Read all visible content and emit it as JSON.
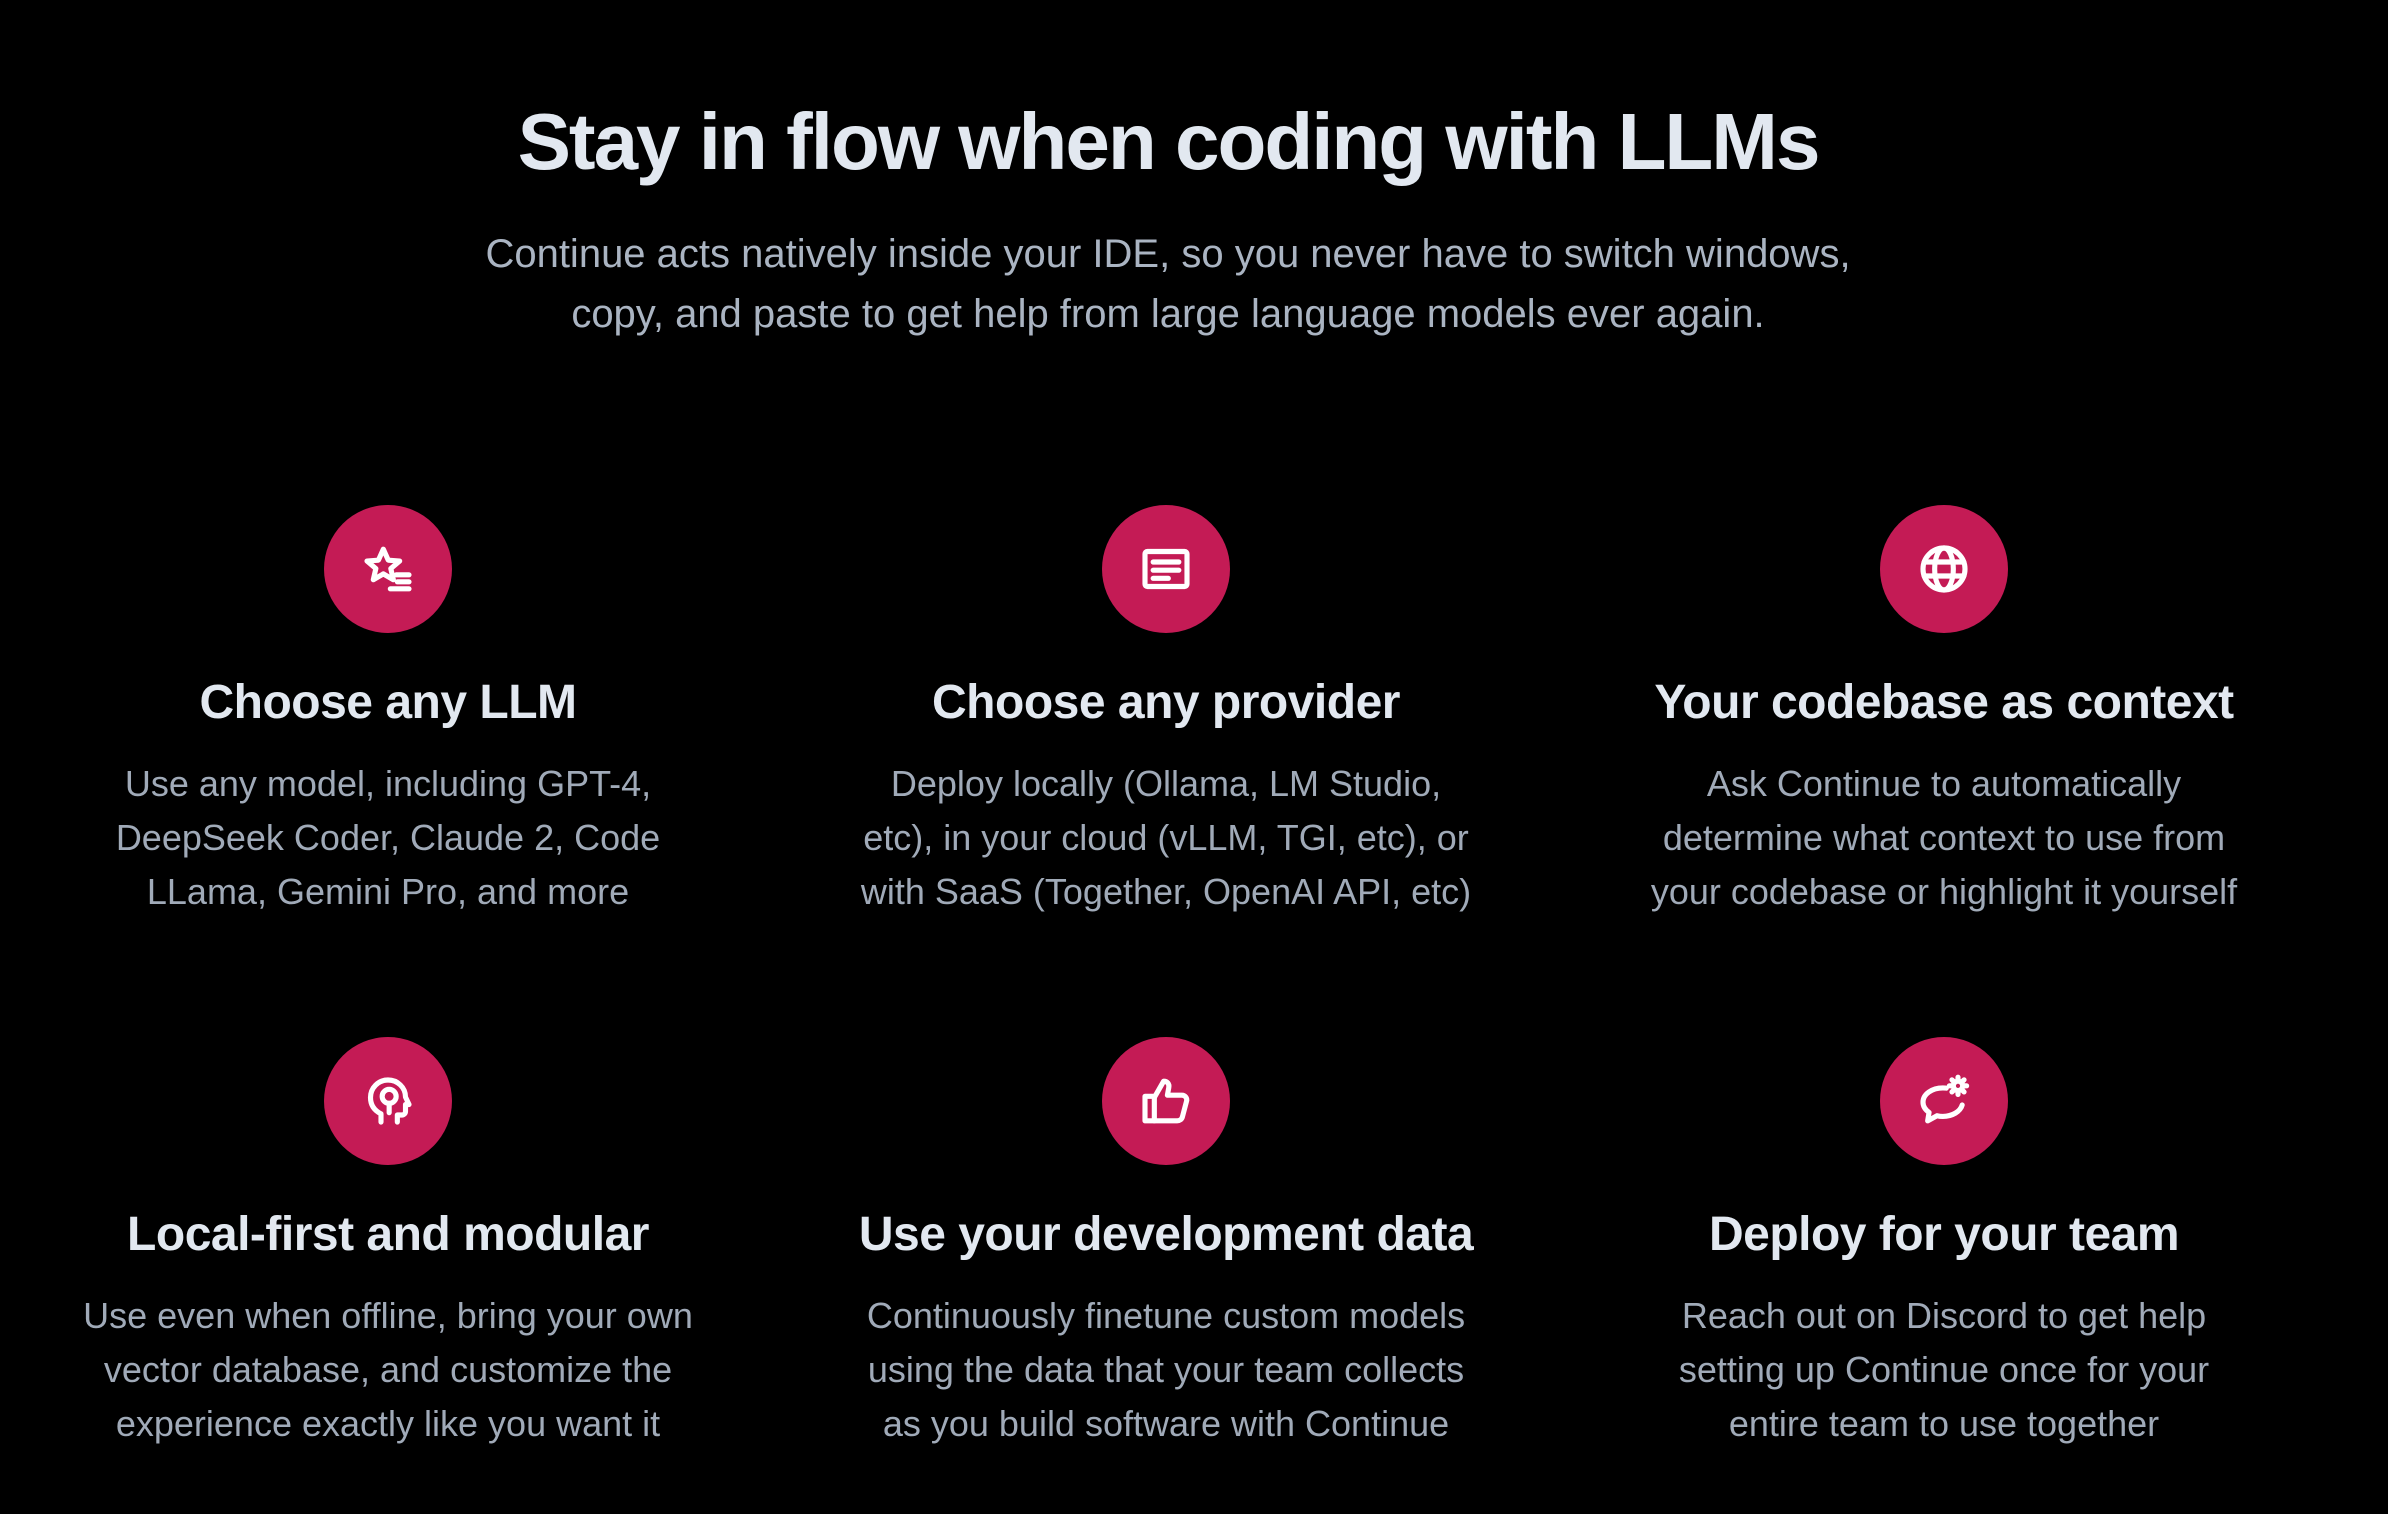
{
  "hero": {
    "title": "Stay in flow when coding with LLMs",
    "subtitle_lines": [
      "Continue acts natively inside your IDE, so you never have to switch windows,",
      "copy, and paste to get help from large language models ever again."
    ]
  },
  "accent_color": "#c41b55",
  "features": [
    {
      "icon": "star-list-icon",
      "title": "Choose any LLM",
      "desc_lines": [
        "Use any model, including GPT-4,",
        "DeepSeek Coder, Claude 2, Code",
        "LLama, Gemini Pro, and more"
      ]
    },
    {
      "icon": "document-icon",
      "title": "Choose any provider",
      "desc_lines": [
        "Deploy locally (Ollama, LM Studio,",
        "etc), in your cloud (vLLM, TGI, etc), or",
        "with SaaS (Together, OpenAI API, etc)"
      ]
    },
    {
      "icon": "globe-icon",
      "title": "Your codebase as context",
      "desc_lines": [
        "Ask Continue to automatically",
        "determine what context to use from",
        "your codebase or highlight it yourself"
      ]
    },
    {
      "icon": "head-idea-icon",
      "title": "Local-first and modular",
      "desc_lines": [
        "Use even when offline, bring your own",
        "vector database, and customize the",
        "experience exactly like you want it"
      ]
    },
    {
      "icon": "thumbs-up-icon",
      "title": "Use your development data",
      "desc_lines": [
        "Continuously finetune custom models",
        "using the data that your team collects",
        "as you build software with Continue"
      ]
    },
    {
      "icon": "chat-gear-icon",
      "title": "Deploy for your team",
      "desc_lines": [
        "Reach out on Discord to get help",
        "setting up Continue once for your",
        "entire team to use together"
      ]
    }
  ]
}
